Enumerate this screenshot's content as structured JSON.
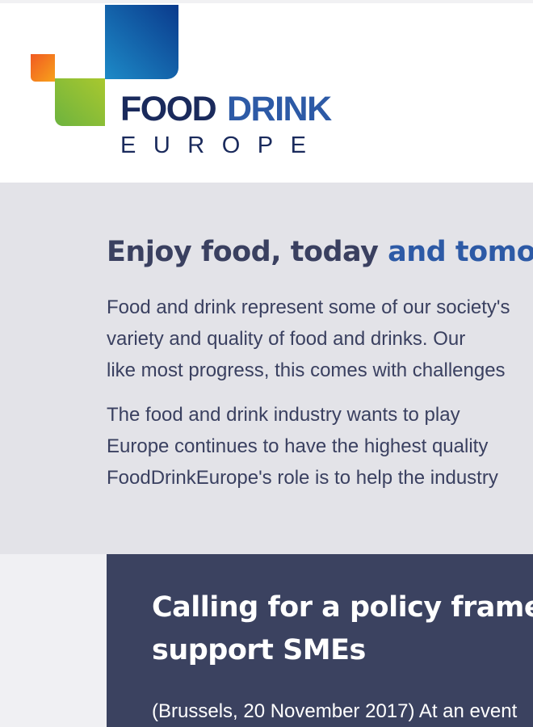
{
  "brand": {
    "name_part1": "FOOD",
    "name_part2": "DRINK",
    "name_sub": "EUROPE",
    "colors": {
      "navy": "#1a2a5c",
      "blue": "#2d5aa6",
      "green": "#7fb81c",
      "orange": "#ef7d00"
    }
  },
  "intro": {
    "heading_main": "Enjoy food, today ",
    "heading_accent": "and tomorrow",
    "paragraph1_lines": [
      "Food and drink represent some of our society's",
      "variety and quality of food and drinks. Our",
      "like most progress, this comes with challenges"
    ],
    "paragraph2_lines": [
      "The food and drink industry wants to play",
      "Europe continues to have the highest quality",
      "FoodDrinkEurope's role is to help the industry"
    ]
  },
  "news": {
    "title_lines": [
      "Calling for a policy framework to",
      "support SMEs"
    ],
    "excerpt": "(Brussels, 20 November 2017) At an event"
  },
  "colors": {
    "heading_text": "#3a4060",
    "accent": "#2d5aa6",
    "intro_bg": "#e3e3e8",
    "card_bg": "#3b4260"
  }
}
